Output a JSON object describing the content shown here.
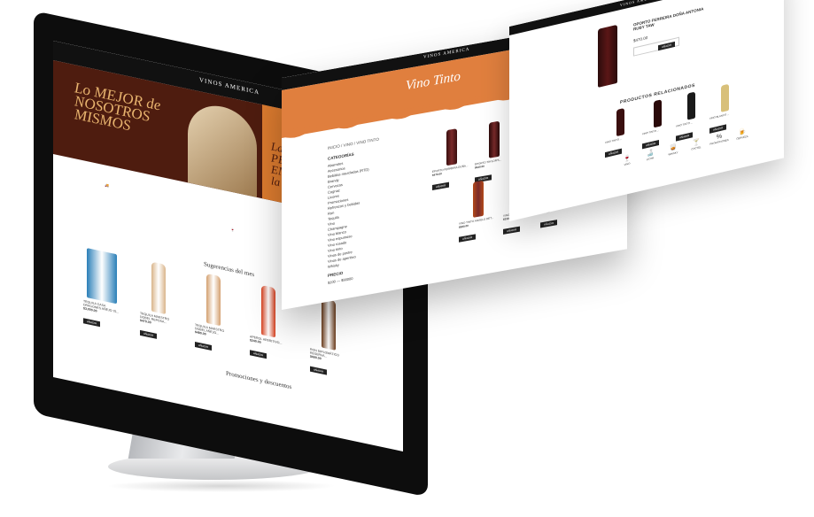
{
  "brand": "VINOS AMERICA",
  "home": {
    "hero_title": [
      "Lo MEJOR de",
      "NOSOTROS",
      "MISMOS"
    ],
    "hero_script": [
      "La COMB",
      "PERFE",
      "ENTRE L",
      "la GLO"
    ],
    "suggestions_title": "Sugerencias del mes",
    "promotions_title": "Promociones y descuentos",
    "products": [
      {
        "name": "TEQUILA CASA DRAGONES AÑEJO 75...",
        "price": "$3,000.00",
        "button": "AÑADIR",
        "color": "#2a7fb8"
      },
      {
        "name": "TEQUILA MAESTRO DOBEL REPOSA...",
        "price": "$470.00",
        "button": "AÑADIR",
        "color": "#d9b48a"
      },
      {
        "name": "TEQUILA MAESTRO DOBEL AÑEJO...",
        "price": "$480.00",
        "button": "AÑADIR",
        "color": "#d4a070"
      },
      {
        "name": "APEROL APERITIVO...",
        "price": "$240.00",
        "button": "AÑADIR",
        "color": "#d8401e"
      },
      {
        "name": "RON DIPLOMÁTICO RESERVA...",
        "price": "$690.00",
        "button": "AÑADIR",
        "color": "#6b3b1a"
      }
    ]
  },
  "category": {
    "title": "Vino Tinto",
    "breadcrumb": "INICIO / VINO / VINO TINTO",
    "categories_heading": "CATEGORÍAS",
    "categories": [
      "Abarrotes",
      "Accesorios",
      "Bebidas mezcladas (RTD)",
      "Brandy",
      "Cervezas",
      "Cognac",
      "Licores",
      "Promociones",
      "Refrescos y bebidas",
      "Ron",
      "Tequila",
      "Vino",
      "Champagne",
      "Vino blanco",
      "Vino espumoso",
      "Vino rosado",
      "Vino tinto",
      "Vinos de postre",
      "Vinos de aperitivo",
      "Whisky"
    ],
    "price_heading": "PRECIO",
    "price_range": "$100 — $90000",
    "products": [
      {
        "name": "EPORTO FERREIRA DOÑA...",
        "price": "$470.00",
        "button": "AÑADIR"
      },
      {
        "name": "EPORTO TAYLOR'S...",
        "price": "$520.00",
        "button": "AÑADIR"
      },
      {
        "name": "VINO TINTO RESERVA...",
        "price": "$650.00",
        "button": "AÑADIR"
      },
      {
        "name": "VINO TINTO ANGELO DET...",
        "price": "$560.00",
        "button": "AÑADIR"
      },
      {
        "name": "VINO TINTO MALBEC...",
        "price": "$330.00",
        "button": "AÑADIR"
      },
      {
        "name": "VINO TINTO CABERNET...",
        "price": "$410.00",
        "button": "AÑADIR"
      }
    ]
  },
  "product_page": {
    "name": "OPORTO FERREIRA DOÑA ANTONIA RUBY TAW",
    "price": "$470.00",
    "related_title": "PRODUCTOS RELACIONADOS",
    "related": [
      {
        "name": "VINO TINTO ...",
        "button": "AÑADIR"
      },
      {
        "name": "VINO TINTO ...",
        "button": "AÑADIR"
      },
      {
        "name": "VINO TINTO ...",
        "button": "AÑADIR"
      },
      {
        "name": "VINO BLANCO ...",
        "button": "AÑADIR"
      }
    ],
    "icons": [
      "VINO",
      "LICOR",
      "WHISKY",
      "COCTEL",
      "PROMOCIONES",
      "CERVEZA"
    ]
  }
}
